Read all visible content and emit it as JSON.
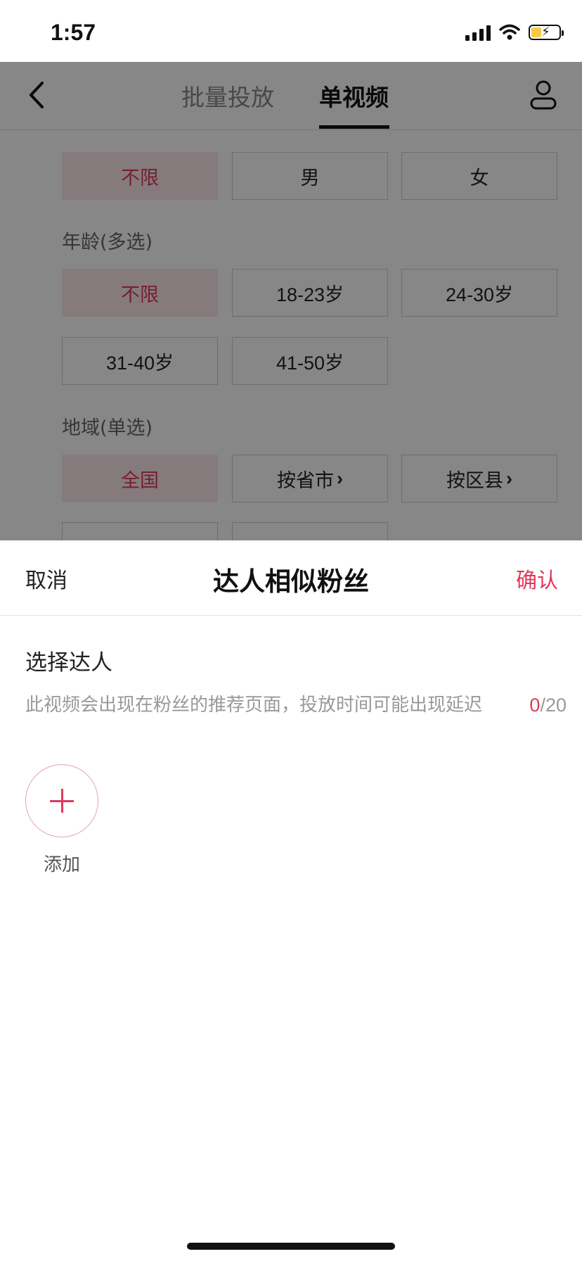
{
  "status_bar": {
    "time": "1:57"
  },
  "nav": {
    "tab_batch": "批量投放",
    "tab_single": "单视频"
  },
  "gender": {
    "options": [
      "不限",
      "男",
      "女"
    ]
  },
  "age": {
    "label": "年龄(多选)",
    "options": [
      "不限",
      "18-23岁",
      "24-30岁",
      "31-40岁",
      "41-50岁"
    ]
  },
  "region": {
    "label": "地域(单选)",
    "options": [
      "全国",
      "按省市",
      "按区县"
    ]
  },
  "sheet": {
    "cancel": "取消",
    "title": "达人相似粉丝",
    "confirm": "确认",
    "section_title": "选择达人",
    "description": "此视频会出现在粉丝的推荐页面，投放时间可能出现延迟",
    "count_current": "0",
    "count_max": "/20",
    "add_label": "添加"
  },
  "colors": {
    "accent": "#e0395a",
    "selected_bg": "#fbe9ec"
  }
}
